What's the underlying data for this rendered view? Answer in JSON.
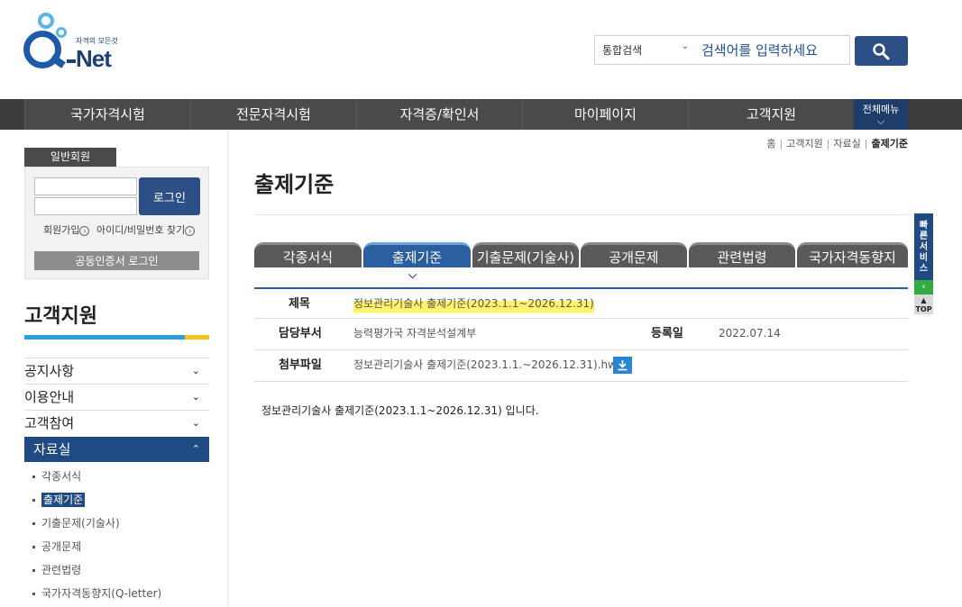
{
  "header": {
    "logo_text": "Net",
    "logo_slogan": "자격의 모든것",
    "search_type": "통합검색",
    "search_placeholder": "검색어를 입력하세요"
  },
  "topnav": {
    "items": [
      "국가자격시험",
      "전문자격시험",
      "자격증/확인서",
      "마이페이지",
      "고객지원"
    ],
    "all_menu": "전체메뉴"
  },
  "sidebar": {
    "member_tab": "일반회원",
    "login_button": "로그인",
    "join_link": "회원가입",
    "find_link": "아이디/비밀번호 찾기",
    "cert_button": "공동인증서 로그인",
    "section_title": "고객지원",
    "menu": [
      "공지사항",
      "이용안내",
      "고객참여",
      "자료실"
    ],
    "submenu": [
      "각종서식",
      "출제기준",
      "기출문제(기술사)",
      "공개문제",
      "관련법령",
      "국가자격동향지(Q-letter)"
    ]
  },
  "breadcrumb": [
    "홈",
    "고객지원",
    "자료실",
    "출제기준"
  ],
  "main": {
    "title": "출제기준",
    "tabs": [
      "각종서식",
      "출제기준",
      "기출문제(기술사)",
      "공개문제",
      "관련법령",
      "국가자격동향지"
    ],
    "active_tab": "출제기준",
    "rows": {
      "subject_label": "제목",
      "subject_value": "정보관리기술사 출제기준(2023.1.1~2026.12.31)",
      "dept_label": "담당부서",
      "dept_value": "능력평가국 자격분석설계부",
      "date_label": "등록일",
      "date_value": "2022.07.14",
      "file_label": "첨부파일",
      "file_value": "정보관리기술사 출제기준(2023.1.1.~2026.12.31).hwp"
    },
    "body": "정보관리기술사 출제기준(2023.1.1~2026.12.31) 입니다."
  },
  "quick": {
    "label": "빠른서비스",
    "top": "TOP"
  },
  "colors": {
    "brand_navy": "#1f4a82",
    "tab_active": "#2c5fa0",
    "nav_bg": "#3d3d3d",
    "highlight": "#fff36b"
  }
}
